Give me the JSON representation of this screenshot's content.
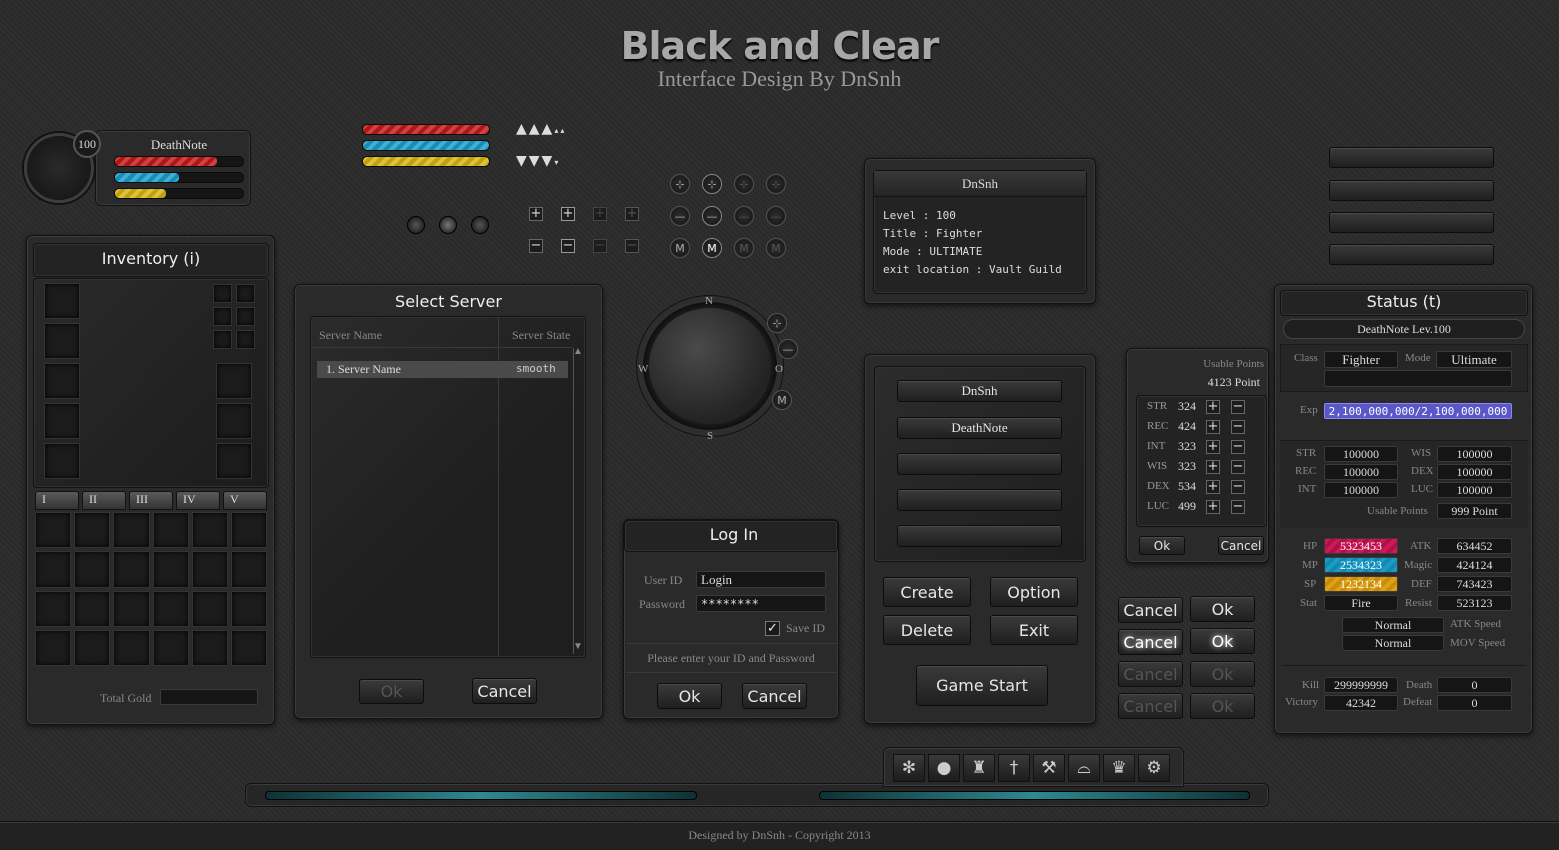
{
  "header": {
    "title": "Black and Clear",
    "subtitle": "Interface Design By DnSnh"
  },
  "player": {
    "level": "100",
    "name": "DeathNote",
    "hp": 0.8,
    "mp": 0.5,
    "sp": 0.4
  },
  "colors": {
    "hp": "#c41818",
    "mp": "#1a9cc8",
    "sp": "#d4b412",
    "exp": "#5a58c8"
  },
  "inventory": {
    "title": "Inventory (i)",
    "tabs": [
      "I",
      "II",
      "III",
      "IV",
      "V"
    ],
    "gold_label": "Total Gold",
    "gold_value": ""
  },
  "server": {
    "title": "Select Server",
    "col_name": "Server Name",
    "col_state": "Server State",
    "rows": [
      {
        "name": "1. Server Name",
        "state": "smooth"
      }
    ],
    "ok": "Ok",
    "cancel": "Cancel"
  },
  "compass": {
    "n": "N",
    "w": "W",
    "o": "O",
    "s": "S",
    "m": "M"
  },
  "buttons": {
    "m": "M"
  },
  "login": {
    "title": "Log In",
    "user_label": "User ID",
    "user_value": "Login",
    "pass_label": "Password",
    "pass_value": "********",
    "save": "Save ID",
    "hint": "Please enter your ID and Password",
    "ok": "Ok",
    "cancel": "Cancel"
  },
  "info": {
    "title": "DnSnh",
    "lines": [
      "Level : 100",
      "Title : Fighter",
      "Mode : ULTIMATE",
      "exit location : Vault Guild"
    ]
  },
  "chars": {
    "slots": [
      "DnSnh",
      "DeathNote",
      "",
      "",
      ""
    ],
    "create": "Create",
    "option": "Option",
    "delete": "Delete",
    "exit": "Exit",
    "start": "Game Start"
  },
  "points": {
    "label": "Usable Points",
    "value": "4123 Point",
    "stats": [
      {
        "k": "STR",
        "v": "324"
      },
      {
        "k": "REC",
        "v": "424"
      },
      {
        "k": "INT",
        "v": "323"
      },
      {
        "k": "WIS",
        "v": "323"
      },
      {
        "k": "DEX",
        "v": "534"
      },
      {
        "k": "LUC",
        "v": "499"
      }
    ],
    "ok": "Ok",
    "cancel": "Cancel"
  },
  "btnstates": {
    "cancel": "Cancel",
    "ok": "Ok"
  },
  "status": {
    "title": "Status (t)",
    "name": "DeathNote Lev.100",
    "class_label": "Class",
    "class": "Fighter",
    "mode_label": "Mode",
    "mode": "Ultimate",
    "exp_label": "Exp",
    "exp": "2,100,000,000/2,100,000,000",
    "left": [
      {
        "k": "STR",
        "v": "100000"
      },
      {
        "k": "REC",
        "v": "100000"
      },
      {
        "k": "INT",
        "v": "100000"
      }
    ],
    "right": [
      {
        "k": "WIS",
        "v": "100000"
      },
      {
        "k": "DEX",
        "v": "100000"
      },
      {
        "k": "LUC",
        "v": "100000"
      }
    ],
    "usable_label": "Usable Points",
    "usable": "999 Point",
    "hp_label": "HP",
    "hp": "5323453",
    "mp_label": "MP",
    "mp": "2534323",
    "sp_label": "SP",
    "sp": "1232134",
    "stat_label": "Stat",
    "stat": "Fire",
    "atk_label": "ATK",
    "atk": "634452",
    "magic_label": "Magic",
    "magic": "424124",
    "def_label": "DEF",
    "def": "743423",
    "resist_label": "Resist",
    "resist": "523123",
    "atkspd": "Normal",
    "atkspd_label": "ATK Speed",
    "movspd": "Normal",
    "movspd_label": "MOV Speed",
    "kill_label": "Kill",
    "kill": "299999999",
    "death_label": "Death",
    "death": "0",
    "victory_label": "Victory",
    "victory": "42342",
    "defeat_label": "Defeat",
    "defeat": "0"
  },
  "footer": "Designed by DnSnh - Copyright 2013"
}
